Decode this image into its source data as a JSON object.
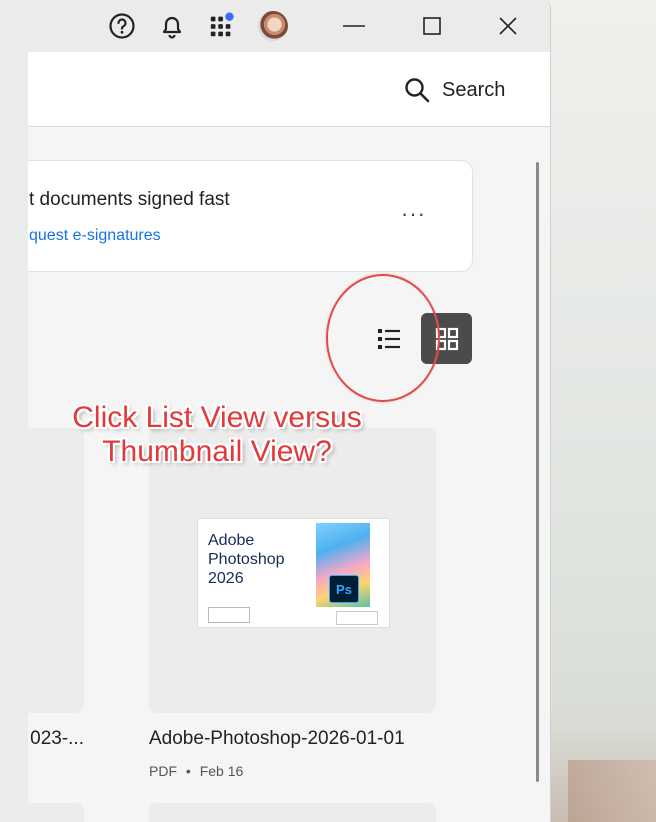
{
  "titlebar": {
    "icons": [
      "help-icon",
      "bell-icon",
      "apps-icon",
      "avatar",
      "minimize-icon",
      "maximize-icon",
      "close-icon"
    ]
  },
  "toolbar": {
    "search_label": "Search"
  },
  "banner": {
    "title": "t documents signed fast",
    "link": "quest e-signatures",
    "more": "···"
  },
  "view_toggle": {
    "list_icon": "list-view-icon",
    "grid_icon": "thumbnail-view-icon",
    "active": "thumbnail"
  },
  "annotation": {
    "line1": "Click List View versus",
    "line2": "Thumbnail View?",
    "color": "#e23a3a"
  },
  "files": [
    {
      "name": "023-...",
      "meta": ""
    },
    {
      "name": "Adobe-Photoshop-2026-01-01",
      "type": "PDF",
      "date": "Feb 16",
      "thumbnail": {
        "title_l1": "Adobe",
        "title_l2": "Photoshop",
        "title_l3": "2026",
        "badge": "Ps"
      }
    }
  ],
  "colors": {
    "accent_link": "#1473e6",
    "active_toggle_bg": "#4b4b4b",
    "annotation_circle": "#e14b4b"
  }
}
